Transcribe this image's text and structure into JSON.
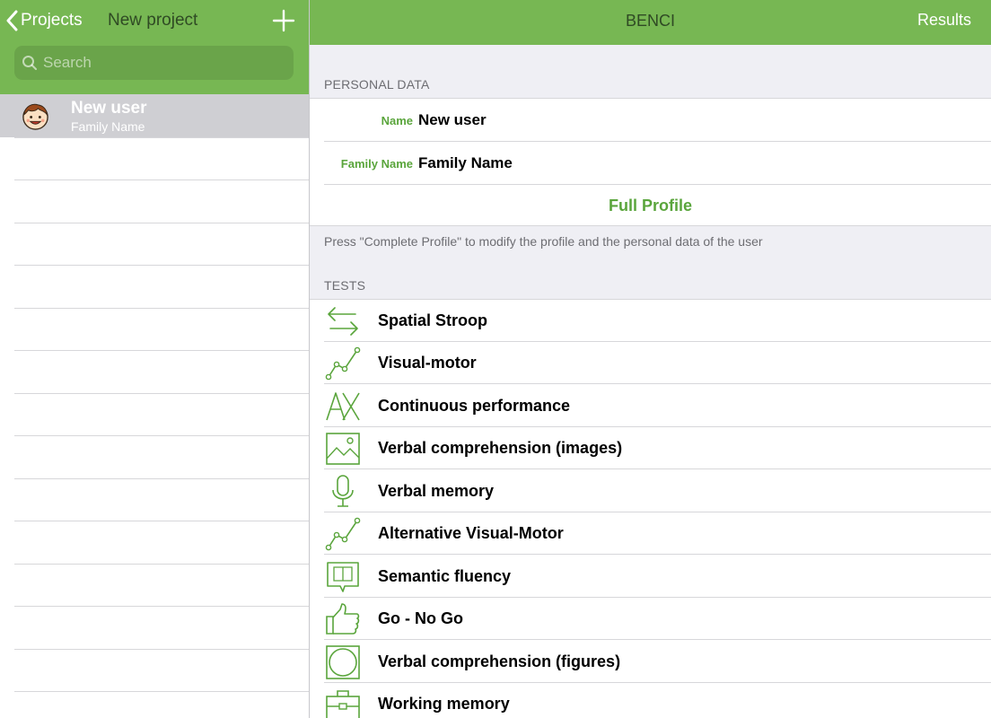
{
  "sidebar": {
    "back_label": "Projects",
    "title": "New project",
    "add_icon": "plus-icon",
    "search_placeholder": "Search",
    "users": [
      {
        "name": "New user",
        "family_name": "Family Name",
        "avatar": "boy-face-avatar"
      }
    ]
  },
  "header": {
    "title": "BENCI",
    "results_label": "Results"
  },
  "personal": {
    "section_label": "PERSONAL DATA",
    "name_label": "Name",
    "name_value": "New user",
    "family_label": "Family Name",
    "family_value": "Family Name",
    "full_profile_label": "Full Profile",
    "note": "Press \"Complete Profile\" to modify the profile and the personal data of the user"
  },
  "tests": {
    "section_label": "TESTS",
    "items": [
      {
        "label": "Spatial Stroop",
        "icon": "arrows-left-right-icon"
      },
      {
        "label": "Visual-motor",
        "icon": "line-graph-icon"
      },
      {
        "label": "Continuous performance",
        "icon": "ax-letters-icon"
      },
      {
        "label": "Verbal comprehension (images)",
        "icon": "picture-icon"
      },
      {
        "label": "Verbal memory",
        "icon": "microphone-icon"
      },
      {
        "label": "Alternative Visual-Motor",
        "icon": "line-graph-icon"
      },
      {
        "label": "Semantic fluency",
        "icon": "book-speech-bubble-icon"
      },
      {
        "label": "Go - No Go",
        "icon": "thumbs-up-icon"
      },
      {
        "label": "Verbal comprehension (figures)",
        "icon": "circle-in-square-icon"
      },
      {
        "label": "Working memory",
        "icon": "briefcase-icon"
      }
    ]
  },
  "colors": {
    "header_green": "#77b753",
    "accent_green": "#5aa53c",
    "selected_row": "#cfcfd3"
  }
}
